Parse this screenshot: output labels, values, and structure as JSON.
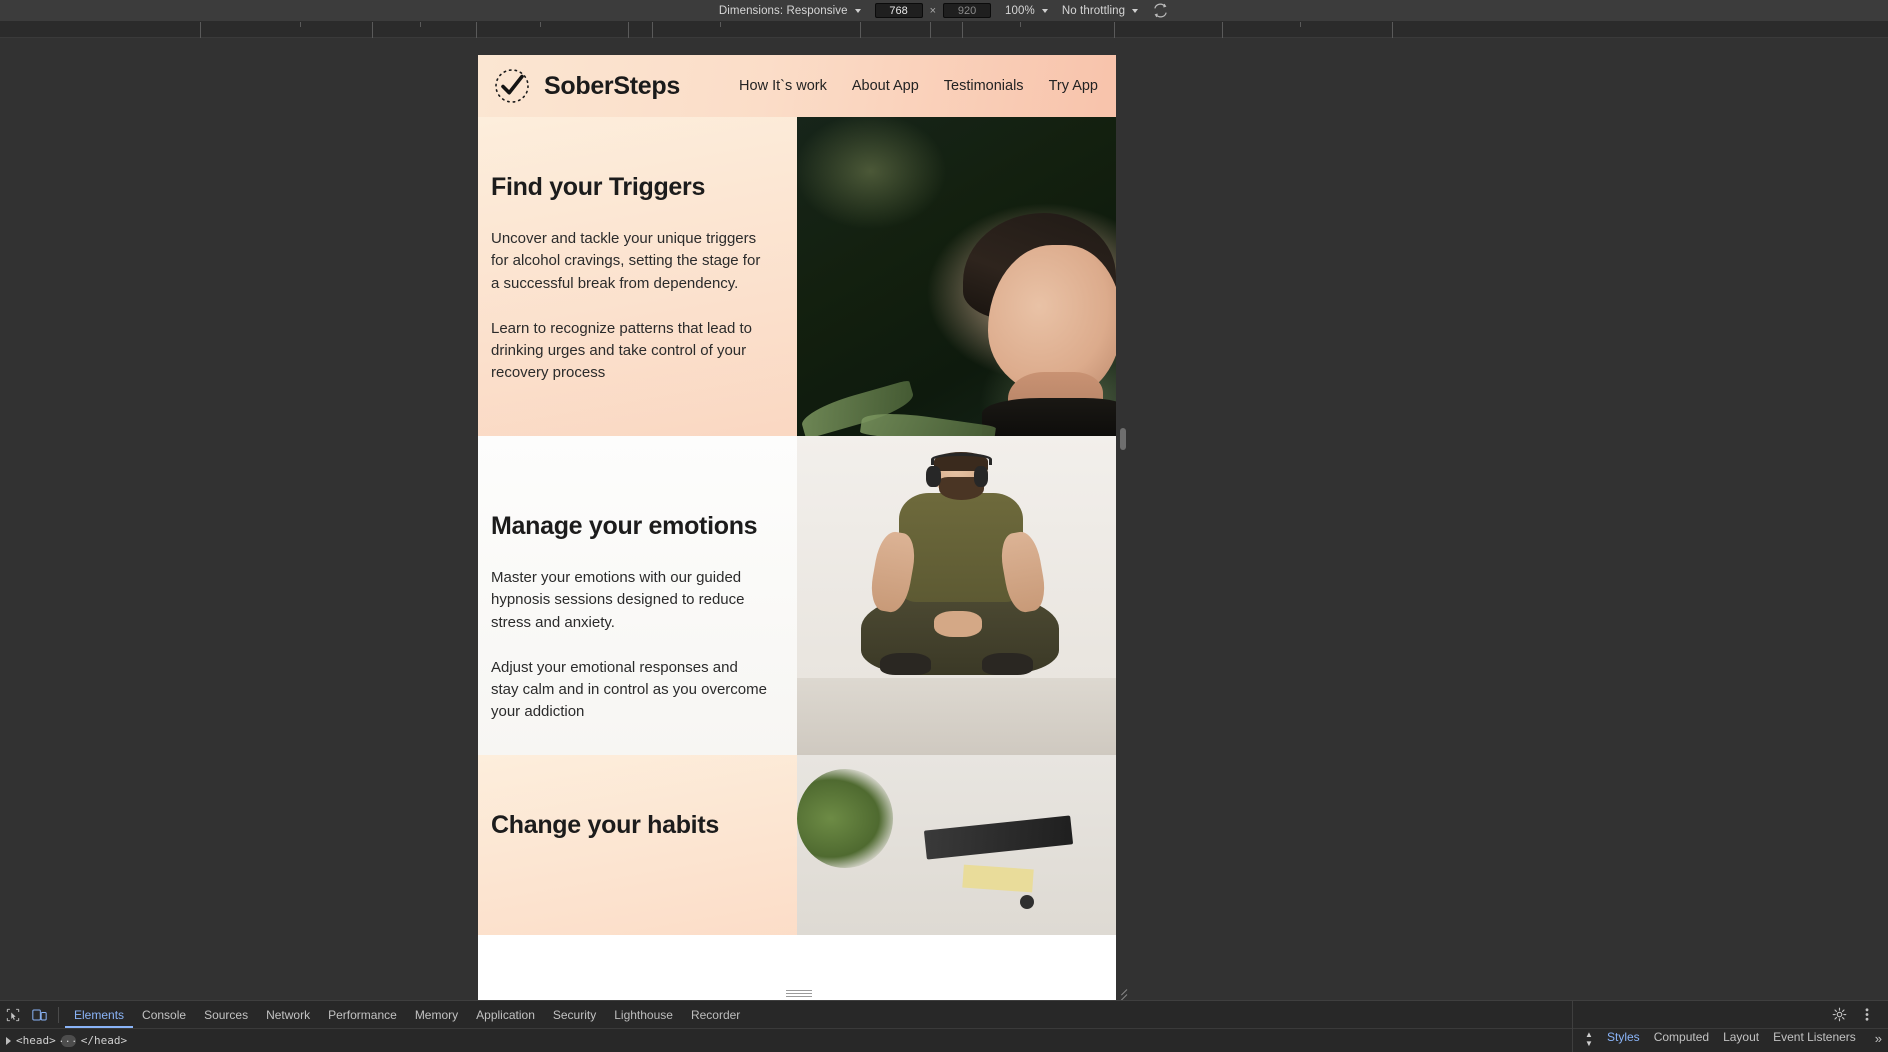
{
  "device_toolbar": {
    "dimensions_label": "Dimensions: Responsive",
    "width_value": "768",
    "height_placeholder": "920",
    "separator": "×",
    "zoom_label": "100%",
    "throttling_label": "No throttling",
    "rotate_icon": "rotate-icon"
  },
  "site": {
    "brand": "SoberSteps",
    "logo_icon": "checkmark-circle-icon",
    "nav": [
      {
        "label": "How It`s work"
      },
      {
        "label": "About App"
      },
      {
        "label": "Testimonials"
      },
      {
        "label": "Try App"
      }
    ],
    "sections": [
      {
        "title": "Find your Triggers",
        "paragraphs": [
          "Uncover and tackle your unique triggers for alcohol cravings, setting the stage for a successful break from dependency.",
          "Learn to recognize patterns that lead to drinking urges and take control of your recovery process"
        ],
        "image_alt": "woman-eyes-closed-photo"
      },
      {
        "title": "Manage your emotions",
        "paragraphs": [
          "Master your emotions with our guided hypnosis sessions designed to reduce stress and anxiety.",
          "Adjust your emotional responses and stay calm and in control as you overcome your addiction"
        ],
        "image_alt": "man-with-headphones-photo"
      },
      {
        "title": "Change your habits",
        "paragraphs": [],
        "image_alt": "desk-with-notebook-photo"
      }
    ],
    "colors": {
      "peach_light": "#fdeedc",
      "peach_deep": "#f8c3ab",
      "text_dark": "#1c1c1c"
    }
  },
  "devtools": {
    "inspect_icon": "inspect-element-icon",
    "device_toggle_icon": "device-toolbar-icon",
    "tabs": [
      {
        "label": "Elements",
        "active": true
      },
      {
        "label": "Console",
        "active": false
      },
      {
        "label": "Sources",
        "active": false
      },
      {
        "label": "Network",
        "active": false
      },
      {
        "label": "Performance",
        "active": false
      },
      {
        "label": "Memory",
        "active": false
      },
      {
        "label": "Application",
        "active": false
      },
      {
        "label": "Security",
        "active": false
      },
      {
        "label": "Lighthouse",
        "active": false
      },
      {
        "label": "Recorder",
        "active": false
      }
    ],
    "settings_icon": "gear-icon",
    "more_icon": "kebab-menu-icon",
    "breadcrumb": {
      "open_tag": "<head>",
      "ellipsis": "...",
      "close_tag": "</head>"
    },
    "styles_panel": {
      "tabs": [
        {
          "label": "Styles",
          "active": true
        },
        {
          "label": "Computed",
          "active": false
        },
        {
          "label": "Layout",
          "active": false
        },
        {
          "label": "Event Listeners",
          "active": false
        }
      ],
      "overflow_label": "»"
    }
  }
}
